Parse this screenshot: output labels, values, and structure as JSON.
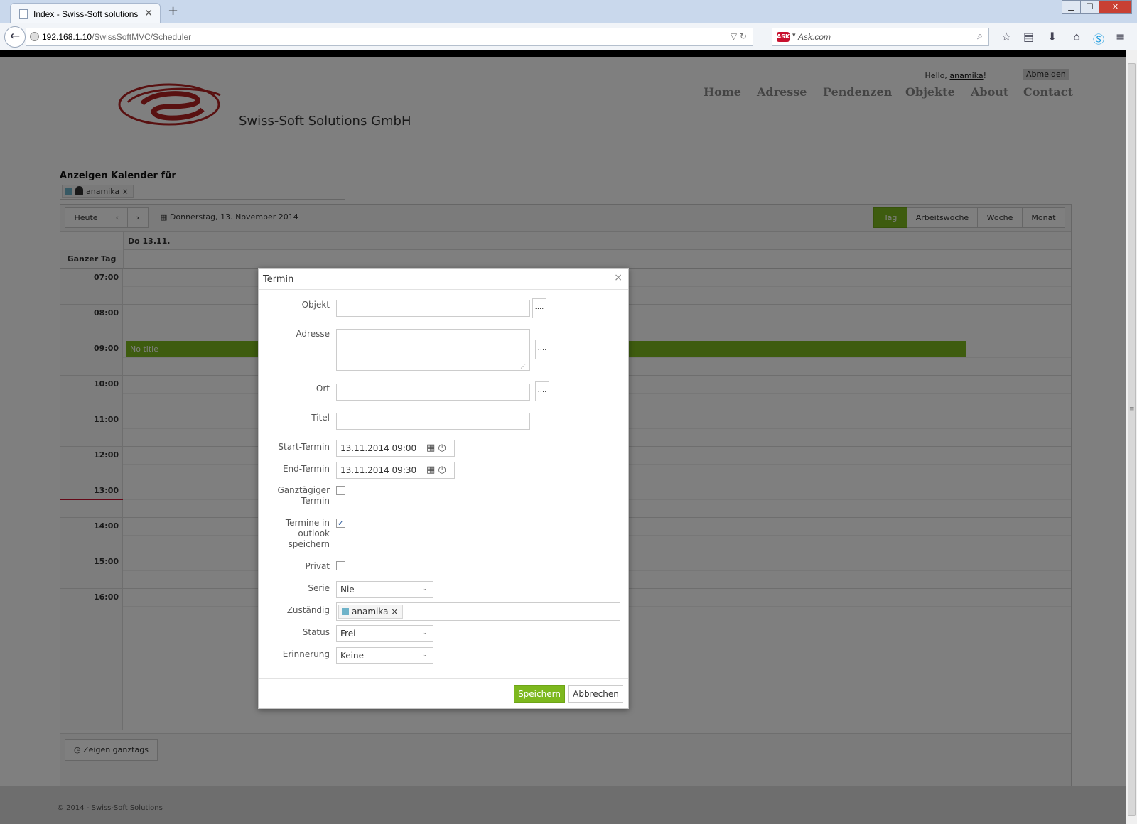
{
  "browser": {
    "tab_title": "Index - Swiss-Soft solutions",
    "url_host": "192.168.1.10",
    "url_path": "/SwissSoftMVC/Scheduler",
    "search_placeholder": "Ask.com"
  },
  "header": {
    "hello_prefix": "Hello,",
    "username": "anamika",
    "hello_suffix": "!",
    "logout_label": "Abmelden",
    "company": "Swiss-Soft Solutions GmbH",
    "nav": [
      "Home",
      "Adresse",
      "Pendenzen",
      "Objekte",
      "About",
      "Contact"
    ]
  },
  "calendar": {
    "heading": "Anzeigen Kalender für",
    "selected_user": "anamika",
    "user_color": "#6fb3c9",
    "today_label": "Heute",
    "prev_icon": "‹",
    "next_icon": "›",
    "current_date": "Donnerstag, 13. November 2014",
    "views": [
      "Tag",
      "Arbeitswoche",
      "Woche",
      "Monat"
    ],
    "active_view": "Tag",
    "day_header": "Do 13.11.",
    "allday_label": "Ganzer Tag",
    "times": [
      "07:00",
      "08:00",
      "09:00",
      "10:00",
      "11:00",
      "12:00",
      "13:00",
      "14:00",
      "15:00",
      "16:00"
    ],
    "event_title": "No title",
    "event_color": "#7db81e",
    "show_allday_label": "Zeigen ganztags"
  },
  "modal": {
    "title": "Termin",
    "labels": {
      "objekt": "Objekt",
      "adresse": "Adresse",
      "ort": "Ort",
      "titel": "Titel",
      "start": "Start-Termin",
      "end": "End-Termin",
      "allday_1": "Ganztägiger",
      "allday_2": "Termin",
      "outlook_1": "Termine in",
      "outlook_2": "outlook",
      "outlook_3": "speichern",
      "privat": "Privat",
      "serie": "Serie",
      "zustaendig": "Zuständig",
      "status": "Status",
      "erinnerung": "Erinnerung"
    },
    "values": {
      "objekt": "",
      "adresse": "",
      "ort": "",
      "titel": "",
      "start": "13.11.2014 09:00",
      "end": "13.11.2014 09:30",
      "allday_checked": false,
      "outlook_checked": true,
      "privat_checked": false,
      "serie": "Nie",
      "zustaendig": "anamika",
      "status": "Frei",
      "erinnerung": "Keine"
    },
    "dots_label": "....",
    "save_label": "Speichern",
    "cancel_label": "Abbrechen"
  },
  "footer": {
    "text": "© 2014 - Swiss-Soft Solutions"
  },
  "colors": {
    "accent": "#7db81e",
    "now_line": "#c8102e"
  }
}
